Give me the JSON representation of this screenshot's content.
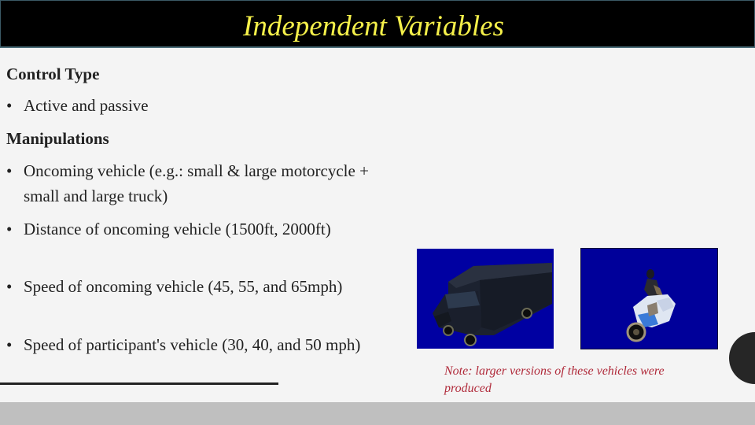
{
  "slide": {
    "title": "Independent Variables",
    "sections": [
      {
        "heading": "Control Type",
        "bullets": [
          "Active and passive"
        ]
      },
      {
        "heading": "Manipulations",
        "bullets": [
          "Oncoming vehicle (e.g.: small & large motorcycle + small and large truck)",
          "Distance of oncoming vehicle (1500ft, 2000ft)",
          "Speed of oncoming vehicle (45, 55, and 65mph)",
          "Speed of participant's vehicle (30, 40, and 50 mph)"
        ]
      }
    ],
    "bullet_glyph": "•",
    "images": [
      {
        "name": "truck-image",
        "description": "dark delivery truck on blue background"
      },
      {
        "name": "motorcycle-image",
        "description": "white and blue motorcycle with rider on blue background"
      }
    ],
    "note": "Note: larger versions of these vehicles were produced",
    "colors": {
      "title_bar": "#000000",
      "title_text": "#f5f04a",
      "note_text": "#b02a3a",
      "image_background": "#0000a2",
      "footer_band": "#bfbfbf"
    }
  }
}
